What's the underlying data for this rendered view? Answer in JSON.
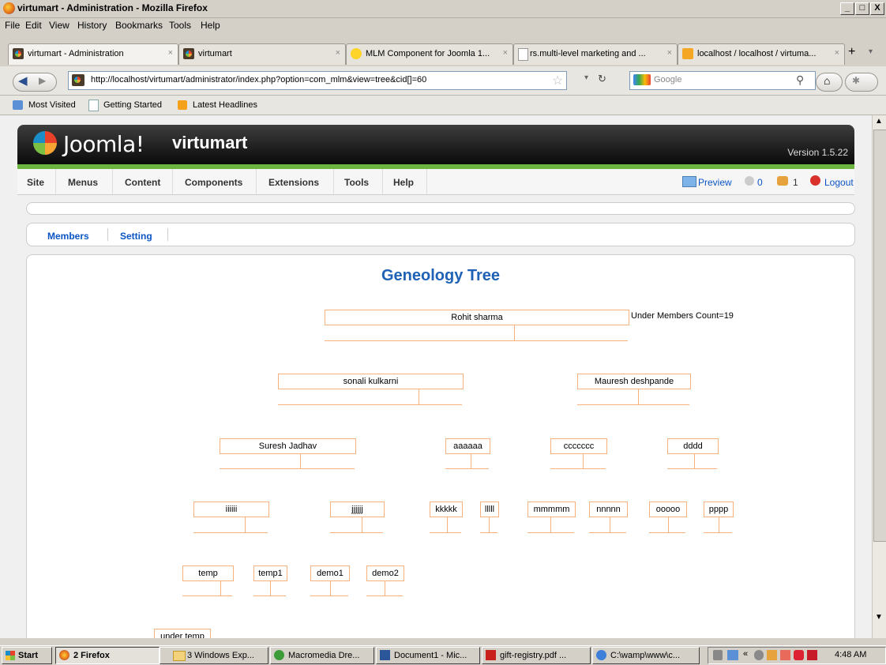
{
  "window": {
    "title": "virtumart - Administration - Mozilla Firefox",
    "controls": [
      "_",
      "□",
      "X"
    ]
  },
  "menubar": [
    "File",
    "Edit",
    "View",
    "History",
    "Bookmarks",
    "Tools",
    "Help"
  ],
  "tabs": [
    {
      "label": "virtumart - Administration",
      "active": true
    },
    {
      "label": "virtumart",
      "active": false
    },
    {
      "label": "MLM Component for Joomla 1...",
      "active": false
    },
    {
      "label": "rs.multi-level marketing and ...",
      "active": false
    },
    {
      "label": "localhost / localhost / virtuma...",
      "active": false
    }
  ],
  "navbar": {
    "url": "http://localhost/virtumart/administrator/index.php?option=com_mlm&view=tree&cid[]=60",
    "search_placeholder": "Google"
  },
  "bookmarks": [
    "Most Visited",
    "Getting Started",
    "Latest Headlines"
  ],
  "joomla": {
    "logo_text": "Joomla!",
    "site_name": "virtumart",
    "version": "Version 1.5.22",
    "menu": [
      "Site",
      "Menus",
      "Content",
      "Components",
      "Extensions",
      "Tools",
      "Help"
    ],
    "right": {
      "preview": "Preview",
      "messages": "0",
      "users": "1",
      "logout": "Logout"
    }
  },
  "submenu": [
    "Members",
    "Setting"
  ],
  "page_title": "Geneology Tree",
  "tree": {
    "root": "Rohit sharma",
    "count_label": "Under Members Count=19",
    "level2": [
      "sonali kulkarni",
      "Mauresh deshpande"
    ],
    "level3": [
      "Suresh Jadhav",
      "aaaaaa",
      "ccccccc",
      "dddd"
    ],
    "level4": [
      "iiiiii",
      "jjjjjj",
      "kkkkk",
      "lllll",
      "mmmmm",
      "nnnnn",
      "ooooo",
      "pppp"
    ],
    "level5": [
      "temp",
      "temp1",
      "demo1",
      "demo2"
    ],
    "level6": [
      "under temp"
    ]
  },
  "taskbar": {
    "start": "Start",
    "items": [
      "2 Firefox",
      "3 Windows Exp...",
      "Macromedia Dre...",
      "Document1 - Mic...",
      "gift-registry.pdf ...",
      "C:\\wamp\\www\\c..."
    ],
    "clock": "4:48 AM"
  }
}
